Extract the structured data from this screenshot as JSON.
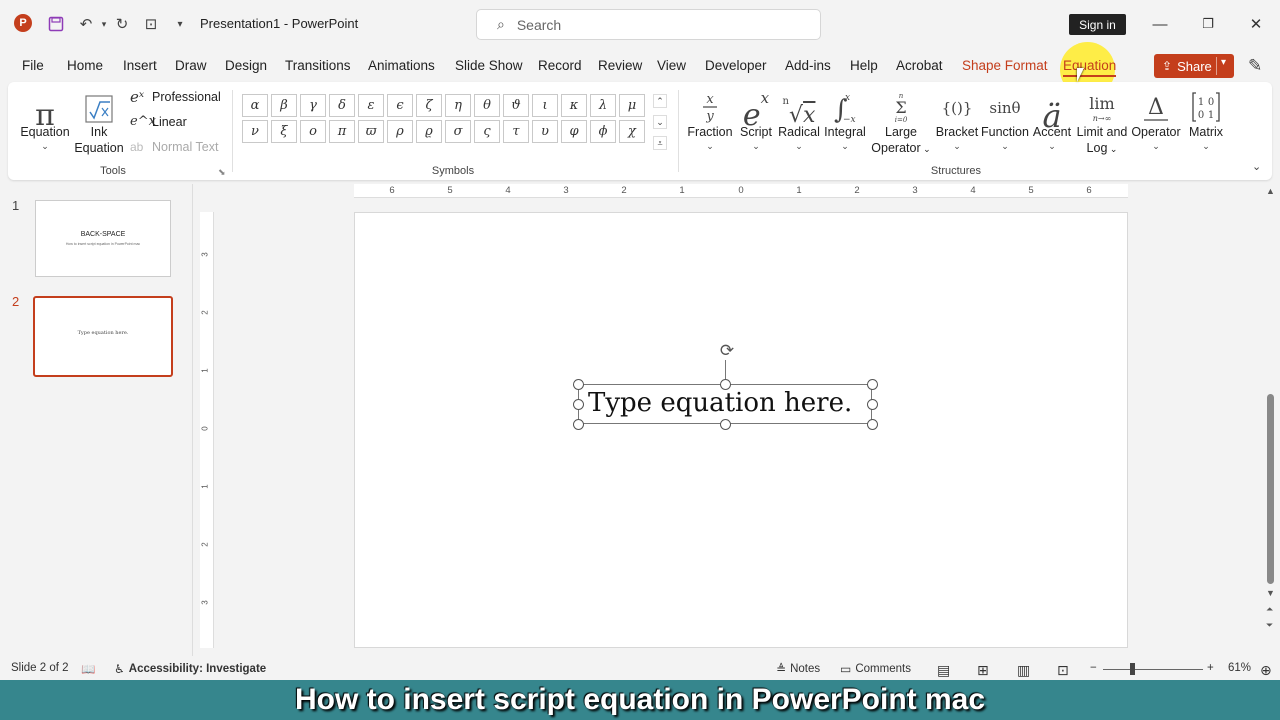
{
  "titlebar": {
    "app_logo": "P",
    "qat_icons": [
      "save-icon",
      "undo-icon",
      "redo-icon",
      "present-icon",
      "customize-icon"
    ],
    "document_title": "Presentation1  -  PowerPoint",
    "search_placeholder": "Search",
    "sign_in": "Sign in"
  },
  "tabs": [
    "File",
    "Home",
    "Insert",
    "Draw",
    "Design",
    "Transitions",
    "Animations",
    "Slide Show",
    "Record",
    "Review",
    "View",
    "Developer",
    "Add-ins",
    "Help",
    "Acrobat",
    "Shape Format",
    "Equation"
  ],
  "active_tab": "Equation",
  "share_label": "Share",
  "ribbon": {
    "tools": {
      "label": "Tools",
      "equation": "Equation",
      "ink_equation_1": "Ink",
      "ink_equation_2": "Equation",
      "professional": "Professional",
      "linear": "Linear",
      "normal_text": "Normal Text"
    },
    "symbols": {
      "label": "Symbols",
      "row1": [
        "α",
        "β",
        "γ",
        "δ",
        "ε",
        "ϵ",
        "ζ",
        "η",
        "θ",
        "ϑ",
        "ι",
        "κ",
        "λ",
        "μ"
      ],
      "row2": [
        "ν",
        "ξ",
        "ο",
        "π",
        "ϖ",
        "ρ",
        "ϱ",
        "σ",
        "ς",
        "τ",
        "υ",
        "φ",
        "ϕ",
        "χ"
      ]
    },
    "structures": {
      "label": "Structures",
      "items": [
        {
          "glyph": "x/y",
          "label1": "Fraction",
          "label2": ""
        },
        {
          "glyph": "eˣ",
          "label1": "Script",
          "label2": ""
        },
        {
          "glyph": "ⁿ√x",
          "label1": "Radical",
          "label2": ""
        },
        {
          "glyph": "∫",
          "label1": "Integral",
          "label2": ""
        },
        {
          "glyph": "Σ",
          "label1": "Large",
          "label2": "Operator"
        },
        {
          "glyph": "{()}",
          "label1": "Bracket",
          "label2": ""
        },
        {
          "glyph": "sinθ",
          "label1": "Function",
          "label2": ""
        },
        {
          "glyph": "ä",
          "label1": "Accent",
          "label2": ""
        },
        {
          "glyph": "lim",
          "label1": "Limit and",
          "label2": "Log"
        },
        {
          "glyph": "Δ",
          "label1": "Operator",
          "label2": ""
        },
        {
          "glyph": "[10 01]",
          "label1": "Matrix",
          "label2": ""
        }
      ]
    }
  },
  "thumbnails": [
    {
      "number": "1",
      "title": "BACK-SPACE",
      "subtitle": "How to insert script equation in PowerPoint mac"
    },
    {
      "number": "2",
      "title": "Type equation here."
    }
  ],
  "ruler_h": [
    "6",
    "5",
    "4",
    "3",
    "2",
    "1",
    "0",
    "1",
    "2",
    "3",
    "4",
    "5",
    "6"
  ],
  "ruler_v": [
    "3",
    "2",
    "1",
    "0",
    "1",
    "2",
    "3"
  ],
  "slide": {
    "equation_placeholder": "Type equation here."
  },
  "statusbar": {
    "slide_info": "Slide 2 of 2",
    "accessibility": "Accessibility: Investigate",
    "notes": "Notes",
    "comments": "Comments",
    "zoom": "61%"
  },
  "caption": "How to insert script equation in PowerPoint mac"
}
